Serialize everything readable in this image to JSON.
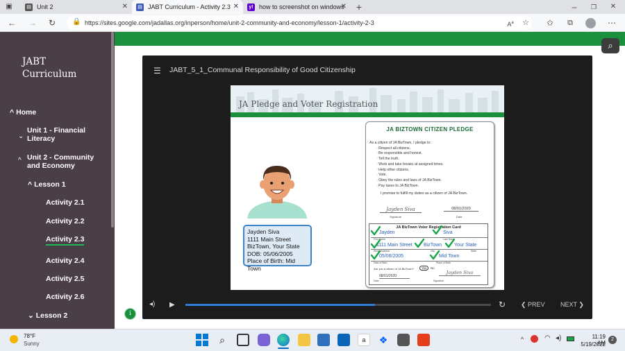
{
  "tabs": [
    {
      "title": "Unit 2",
      "icon": "page-icon"
    },
    {
      "title": "JABT Curriculum - Activity 2.3",
      "icon": "google-sites-icon"
    },
    {
      "title": "how to screenshot on windows",
      "icon": "yahoo-icon"
    }
  ],
  "address": {
    "url": "https://sites.google.com/jadallas.org/inperson/home/unit-2-community-and-economy/lesson-1/activity-2-3"
  },
  "sidebar": {
    "site_title_line1": "JABT",
    "site_title_line2": "Curriculum",
    "items": [
      {
        "label": "Home"
      },
      {
        "label": "Unit 1 - Financial Literacy"
      },
      {
        "label": "Unit 2 - Community and Economy"
      },
      {
        "label": "Lesson 1"
      },
      {
        "label": "Activity 2.1"
      },
      {
        "label": "Activity 2.2"
      },
      {
        "label": "Activity 2.3"
      },
      {
        "label": "Activity 2.4"
      },
      {
        "label": "Activity 2.5"
      },
      {
        "label": "Activity 2.6"
      },
      {
        "label": "Lesson 2"
      }
    ]
  },
  "player": {
    "title": "JABT_5_1_Communal Responsibility of Good Citizenship",
    "slide_title": "JA Pledge and Voter Registration",
    "id_card": {
      "lines": [
        "Jayden Siva",
        "1111 Main Street",
        "BizTown, Your State",
        "DOB:  05/06/2005",
        "Place of Birth:  Mid Town"
      ]
    },
    "pledge": {
      "heading": "JA BIZTOWN CITIZEN PLEDGE",
      "intro": "As a citizen of JA BizTown, I pledge to:",
      "items": [
        "· Respect all citizens.",
        "· Be responsible and honest.",
        "· Tell the truth.",
        "· Work and take breaks at assigned times.",
        "· Help other citizens.",
        "· Vote.",
        "· Obey the rules and laws of JA BizTown.",
        "· Pay taxes to JA BizTown."
      ],
      "promise": "I promise to fulfill my duties as a citizen of JA BizTown.",
      "sig_label": "Signature",
      "date_value": "08/01/2020",
      "date_label": "Date"
    },
    "voter": {
      "title": "JA BizTown Voter Registration Card",
      "first": "Jayden",
      "last": "Siva",
      "address": "1111 Main Street",
      "city": "BizTown",
      "state": "Your State",
      "dob": "05/06/2005",
      "pob": "Mid Town",
      "lbl_first": "First Name",
      "lbl_last": "Last Name",
      "lbl_street": "Street Address",
      "lbl_city": "City",
      "lbl_state": "State",
      "lbl_dob": "Date of Birth",
      "lbl_pob": "Place of Birth",
      "citizen_q": "Are you a citizen of JA BizTown?",
      "yes": "Yes",
      "no": "No",
      "date": "08/01/2020",
      "lbl_date": "Date",
      "lbl_sig": "Signature"
    },
    "progress": 0.62,
    "prev_label": "PREV",
    "next_label": "NEXT"
  },
  "taskbar": {
    "weather_temp": "78°F",
    "weather_desc": "Sunny",
    "time": "11:19 AM",
    "date": "5/19/2022",
    "notif_count": "2"
  }
}
